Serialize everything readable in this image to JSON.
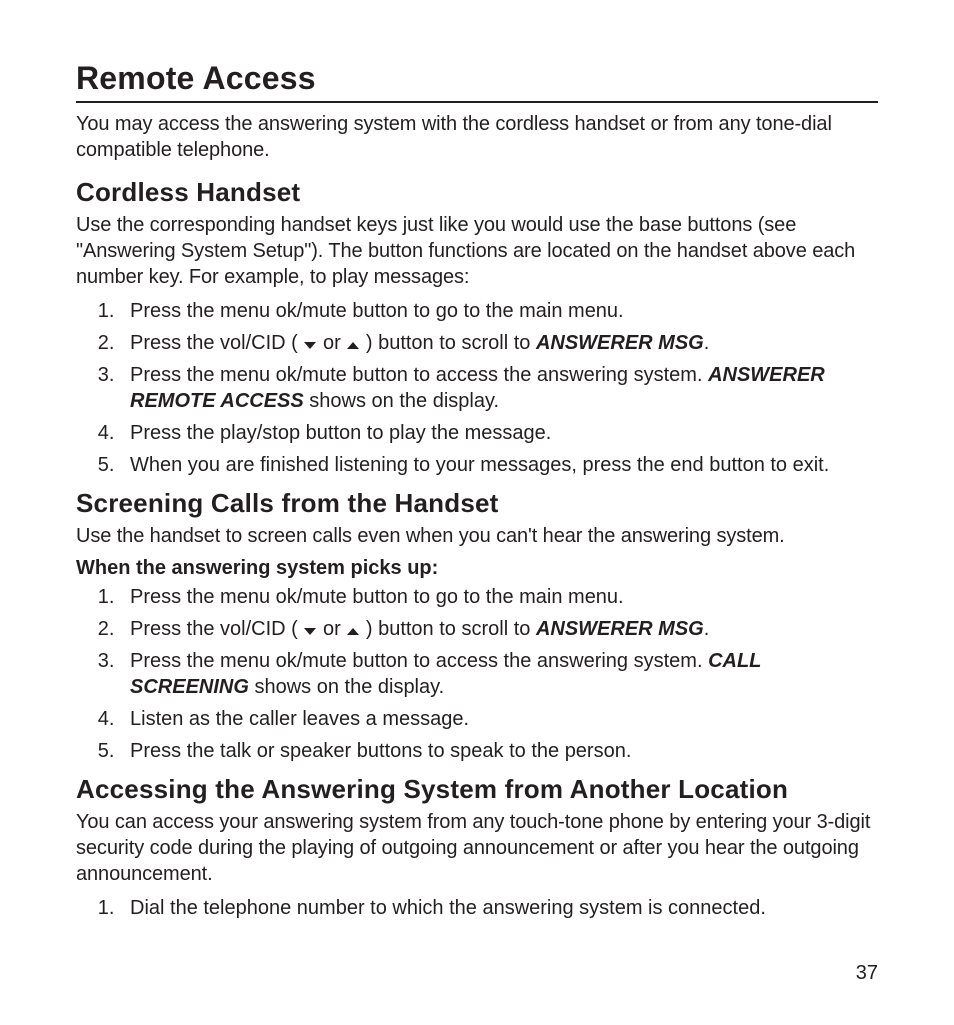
{
  "page": {
    "title": "Remote Access",
    "intro": "You may access the answering system with the cordless handset or from any tone-dial compatible telephone.",
    "number": "37"
  },
  "sec1": {
    "heading": "Cordless Handset",
    "intro": "Use the corresponding handset keys just like you would use the base buttons (see \"Answering System Setup\"). The button functions are located on the handset above each number key. For example, to play messages:",
    "step1": "Press the menu ok/mute button to go to the main menu.",
    "step2_a": "Press the vol/CID ( ",
    "step2_b": " or ",
    "step2_c": " ) button to scroll to ",
    "step2_em": "ANSWERER MSG",
    "step2_d": ".",
    "step3_a": "Press the menu ok/mute button to access the answering system. ",
    "step3_em": "ANSWERER REMOTE ACCESS",
    "step3_b": " shows on the display.",
    "step4": "Press the play/stop button to play the message.",
    "step5": "When you are finished listening to your messages, press the end button to exit."
  },
  "sec2": {
    "heading": "Screening Calls from the Handset",
    "intro": "Use the handset to screen calls even when you can't hear the answering system.",
    "sub": "When the answering system picks up:",
    "step1": "Press the menu ok/mute button to go to the main menu.",
    "step2_a": "Press the vol/CID ( ",
    "step2_b": " or ",
    "step2_c": " ) button to scroll to ",
    "step2_em": "ANSWERER MSG",
    "step2_d": ".",
    "step3_a": "Press the menu ok/mute button to access the answering system. ",
    "step3_em": "CALL SCREENING",
    "step3_b": " shows on the display.",
    "step4": "Listen as the caller leaves a message.",
    "step5": "Press the talk or speaker buttons to speak to the person."
  },
  "sec3": {
    "heading": "Accessing the Answering System from Another Location",
    "intro": "You can access your answering system from any touch-tone phone by entering your 3-digit security code during the playing of outgoing announcement or after you hear the outgoing announcement.",
    "step1": "Dial the telephone number to which the answering system is connected."
  }
}
